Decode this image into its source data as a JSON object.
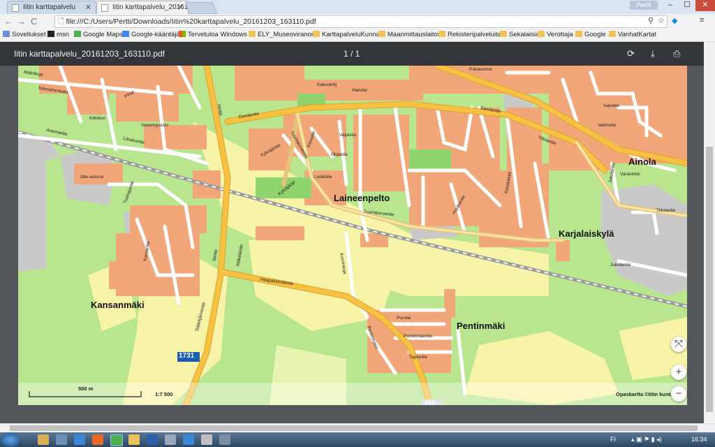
{
  "browser": {
    "tabs": [
      {
        "label": "Iitin karttapalvelu",
        "active": false
      },
      {
        "label": "Iitin karttapalvelu_20161",
        "active": true
      }
    ],
    "profile": "Pertti",
    "url": "file:///C:/Users/Pertti/Downloads/Iitin%20karttapalvelu_20161203_163110.pdf"
  },
  "bookmarks": [
    {
      "label": "Sovellukset",
      "icon": "apps-icon"
    },
    {
      "label": "msn",
      "icon": "msn-icon"
    },
    {
      "label": "Google Maps",
      "icon": "maps-icon"
    },
    {
      "label": "Google-kääntäjä",
      "icon": "translate-icon"
    },
    {
      "label": "Tervetuloa Windows",
      "icon": "windows-icon"
    },
    {
      "label": "ELY_Museoviranom",
      "icon": "folder-icon"
    },
    {
      "label": "KarttapalveluKunnat",
      "icon": "folder-icon"
    },
    {
      "label": "Maanmittauslaitos",
      "icon": "folder-icon"
    },
    {
      "label": "Rekisteripalveluita",
      "icon": "folder-icon"
    },
    {
      "label": "Sekalaisia",
      "icon": "folder-icon"
    },
    {
      "label": "Verottaja",
      "icon": "folder-icon"
    },
    {
      "label": "Google",
      "icon": "folder-icon"
    },
    {
      "label": "VanhatKartat",
      "icon": "folder-icon"
    }
  ],
  "pdf": {
    "title": "Iitin karttapalvelu_20161203_163110.pdf",
    "page_indicator": "1 / 1"
  },
  "map": {
    "places": {
      "laineenpelto": "Laineenpelto",
      "kansanmaki": "Kansanmäki",
      "pentinmaki": "Pentinmäki",
      "karjalaiskyla": "Karjalaiskylä",
      "ainola": "Ainola"
    },
    "streets": {
      "matinkuja": "Matinkuja",
      "telimiehenkatu": "Telimiehenkatu",
      "pihat": "Pihat",
      "kiltokori": "Kiltokori",
      "vieterinpuisto": "Vieterinpuisto",
      "liinakontie": "Liinakontie",
      "asemantie": "Asemantie",
      "eerolantie": "Eerolantie",
      "eerolantie2": "Eerolantie",
      "iitintie": "Iitintie",
      "iitintie2": "Iitintie",
      "tuurinkorventie": "Tuurinkorventie",
      "tuurinkorventie2": "Tuurinkorventie",
      "kyivaajantie": "Kylväjäntie",
      "kyivaajanje": "Kylväjänje",
      "kiessitie": "Kiessitie",
      "ohjastie": "Ohjastie",
      "valjastie": "Valjastie",
      "lukkitie": "Luokkitie",
      "kalevankj": "Kalevankj",
      "hakotie": "Hakotie",
      "paloasema": "Paloasema",
      "tiilolantie": "Tillolantie",
      "tiilolantie2": "Tillolantie",
      "saivatie": "Saivatie",
      "valimotie": "Valimotie",
      "varastotie": "Varastotie",
      "jukolantie": "Jukolantie",
      "jukolantie2": "Jukolantie",
      "haapakimolantie": "Haapakimolantie",
      "saaskjarventie": "Sääskjärventie",
      "kansantie": "Kansantie",
      "purotie": "Purotie",
      "pentinmaentie": "Pentinmäentie",
      "tapiontie": "Tapiontie",
      "jateasema": "Jäte-asema",
      "tuottajantie": "Tuottajantie",
      "kurvinkuja": "Kurvinkuja",
      "makelantie": "Mäkeläntie",
      "karjalaistie": "Karjalaistie",
      "hojakantie": "Hojakantie",
      "pentinmaenkuja": "Pentinmäen"
    },
    "route_number": "1731",
    "route_number_bottom": "360",
    "scale_label": "500 m",
    "scale_ratio": "1:7 500",
    "attribution": "Opaskartta ©Iitin kunta"
  },
  "taskbar": {
    "lang": "FI",
    "time": "16:34"
  },
  "colors": {
    "map_bg": "#b9e58f",
    "building_block": "#f2a77a",
    "road_main": "#f7c244",
    "road_minor": "#ffffff",
    "field": "#f7f3a7",
    "industrial": "#c9c9c9",
    "pdf_toolbar": "#323639"
  }
}
